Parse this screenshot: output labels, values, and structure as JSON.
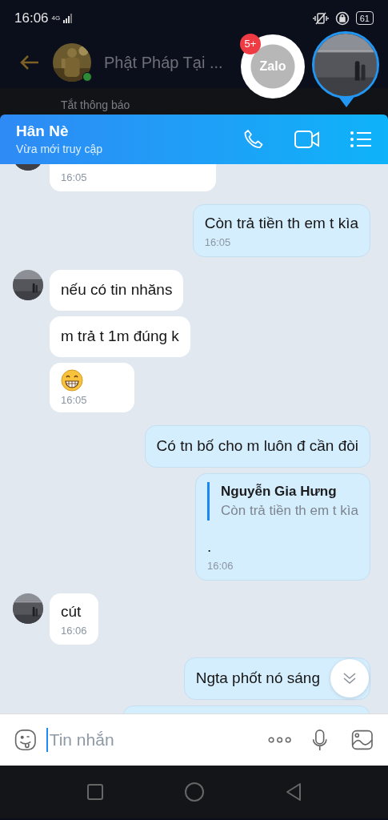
{
  "status_bar": {
    "time": "16:06",
    "network": "4G",
    "battery": "61"
  },
  "background_chat": {
    "title": "Phật Pháp Tại ...",
    "subtitle": "Tắt thông báo"
  },
  "chat_bubble": {
    "logo": "Zalo",
    "badge": "5+"
  },
  "header": {
    "name": "Hân Nè",
    "status": "Vừa mới truy cập"
  },
  "messages": [
    {
      "outgoing": false,
      "kind": "partial",
      "avatar": true,
      "time": "16:05"
    },
    {
      "outgoing": true,
      "kind": "text",
      "text": "Còn trả tiền th em t kìa",
      "time": "16:05"
    },
    {
      "outgoing": false,
      "kind": "text",
      "avatar": true,
      "text": "nếu có tin nhăns"
    },
    {
      "outgoing": false,
      "kind": "text",
      "avatar": false,
      "text": "m trả t 1m đúng k"
    },
    {
      "outgoing": false,
      "kind": "emoji",
      "avatar": false,
      "time": "16:05"
    },
    {
      "outgoing": true,
      "kind": "text",
      "text": "Có tn bố cho m luôn đ cần đòi"
    },
    {
      "outgoing": true,
      "kind": "quote",
      "quote_author": "Nguyễn Gia Hưng",
      "quote_text": "Còn trả tiền th em t kìa",
      "text": ".",
      "time": "16:06"
    },
    {
      "outgoing": false,
      "kind": "text",
      "avatar": true,
      "text": "cút",
      "time": "16:06"
    },
    {
      "outgoing": true,
      "kind": "text",
      "text": "Ngta phốt nó sáng"
    },
    {
      "outgoing": true,
      "kind": "partial"
    }
  ],
  "composer": {
    "placeholder": "Tin nhắn"
  }
}
